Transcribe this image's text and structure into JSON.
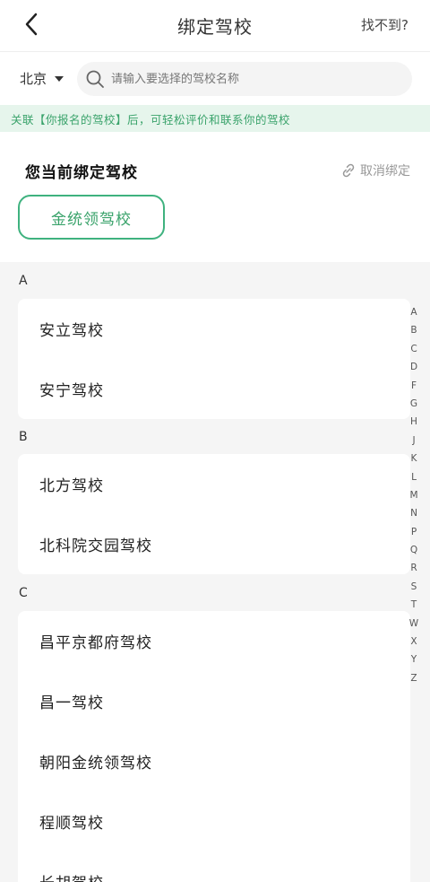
{
  "header": {
    "title": "绑定驾校",
    "not_found": "找不到?"
  },
  "search": {
    "city": "北京",
    "placeholder": "请输入要选择的驾校名称"
  },
  "notice": "关联【你报名的驾校】后，可轻松评价和联系你的驾校",
  "current": {
    "title": "您当前绑定驾校",
    "unbind": "取消绑定",
    "school": "金统领驾校"
  },
  "groups": [
    {
      "letter": "A",
      "schools": [
        "安立驾校",
        "安宁驾校"
      ]
    },
    {
      "letter": "B",
      "schools": [
        "北方驾校",
        "北科院交园驾校"
      ]
    },
    {
      "letter": "C",
      "schools": [
        "昌平京都府驾校",
        "昌一驾校",
        "朝阳金统领驾校",
        "程顺驾校",
        "长胡驾校"
      ]
    }
  ],
  "index_letters": [
    "A",
    "B",
    "C",
    "D",
    "F",
    "G",
    "H",
    "J",
    "K",
    "L",
    "M",
    "N",
    "P",
    "Q",
    "R",
    "S",
    "T",
    "W",
    "X",
    "Y",
    "Z"
  ],
  "colors": {
    "accent": "#3fb27f",
    "notice_bg": "#e6f5ec"
  }
}
